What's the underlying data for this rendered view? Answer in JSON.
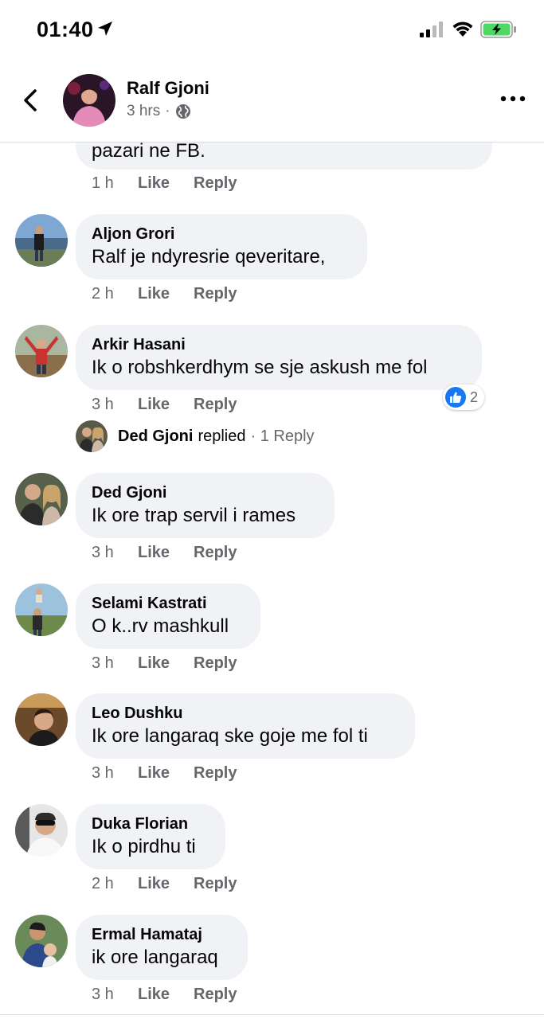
{
  "status_bar": {
    "time": "01:40"
  },
  "header": {
    "name": "Ralf Gjoni",
    "time": "3 hrs",
    "separator": "·"
  },
  "top_comment": {
    "text": "pazari ne FB.",
    "time": "1 h",
    "like": "Like",
    "reply": "Reply"
  },
  "comments": [
    {
      "author": "Aljon Grori",
      "text": "Ralf je ndyresrie qeveritare,",
      "time": "2 h",
      "like": "Like",
      "reply": "Reply"
    },
    {
      "author": "Arkir Hasani",
      "text": "Ik o robshkerdhym se sje askush me fol",
      "time": "3 h",
      "like": "Like",
      "reply": "Reply",
      "reaction_count": "2"
    },
    {
      "author": "Ded Gjoni",
      "text": "Ik ore trap servil i rames",
      "time": "3 h",
      "like": "Like",
      "reply": "Reply"
    },
    {
      "author": "Selami Kastrati",
      "text": "O k..rv mashkull",
      "time": "3 h",
      "like": "Like",
      "reply": "Reply"
    },
    {
      "author": "Leo Dushku",
      "text": "Ik ore langaraq ske goje me fol ti",
      "time": "3 h",
      "like": "Like",
      "reply": "Reply"
    },
    {
      "author": "Duka Florian",
      "text": "Ik o pirdhu ti",
      "time": "2 h",
      "like": "Like",
      "reply": "Reply"
    },
    {
      "author": "Ermal Hamataj",
      "text": "ik ore langaraq",
      "time": "3 h",
      "like": "Like",
      "reply": "Reply"
    }
  ],
  "replied": {
    "name": "Ded Gjoni",
    "word": "replied",
    "count": "· 1 Reply"
  },
  "colors": {
    "bubble": "#f0f2f5",
    "secondary_text": "#65676b",
    "like_blue": "#1877f2",
    "battery_green": "#4cd964"
  }
}
